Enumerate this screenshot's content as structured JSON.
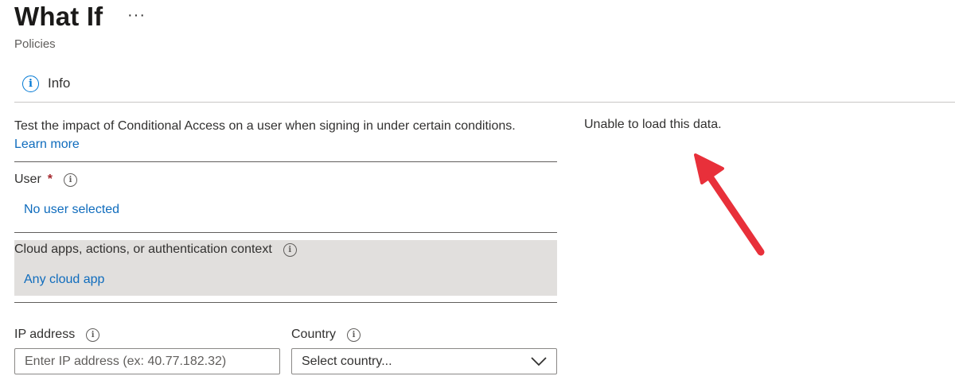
{
  "header": {
    "title": "What If",
    "more_label": "···",
    "subtitle": "Policies"
  },
  "toolbar": {
    "info_label": "Info"
  },
  "form": {
    "description": "Test the impact of Conditional Access on a user when signing in under certain conditions.",
    "learn_more": "Learn more",
    "user": {
      "label": "User",
      "required_mark": "*",
      "value": "No user selected"
    },
    "cloud_apps": {
      "label": "Cloud apps, actions, or authentication context",
      "value": "Any cloud app"
    },
    "ip_address": {
      "label": "IP address",
      "placeholder": "Enter IP address (ex: 40.77.182.32)"
    },
    "country": {
      "label": "Country",
      "value": "Select country..."
    }
  },
  "results": {
    "message": "Unable to load this data."
  },
  "colors": {
    "link": "#0f6cbd",
    "required": "#a4262c",
    "highlight_bg": "#e1dfdd",
    "annotation_arrow": "#e8303a"
  }
}
